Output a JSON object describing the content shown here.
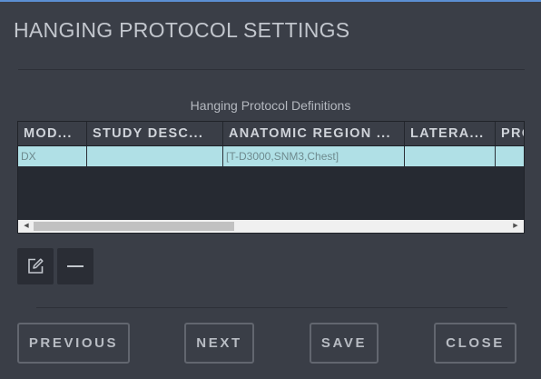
{
  "dialog": {
    "title": "HANGING PROTOCOL SETTINGS",
    "section_label": "Hanging Protocol Definitions"
  },
  "grid": {
    "columns": [
      "MOD...",
      "STUDY DESC...",
      "ANATOMIC REGION ...",
      "LATERA...",
      "PRO"
    ],
    "rows": [
      [
        "DX",
        "",
        "[T-D3000,SNM3,Chest]",
        "",
        ""
      ]
    ]
  },
  "actions": {
    "edit_icon": "pencil-edit-icon",
    "remove_icon": "minus-icon"
  },
  "footer": {
    "previous": "PREVIOUS",
    "next": "NEXT",
    "save": "SAVE",
    "close": "CLOSE"
  },
  "colors": {
    "background": "#3a3e47",
    "selected_row": "#b0e0e6",
    "accent_line": "#5b8fd3"
  }
}
